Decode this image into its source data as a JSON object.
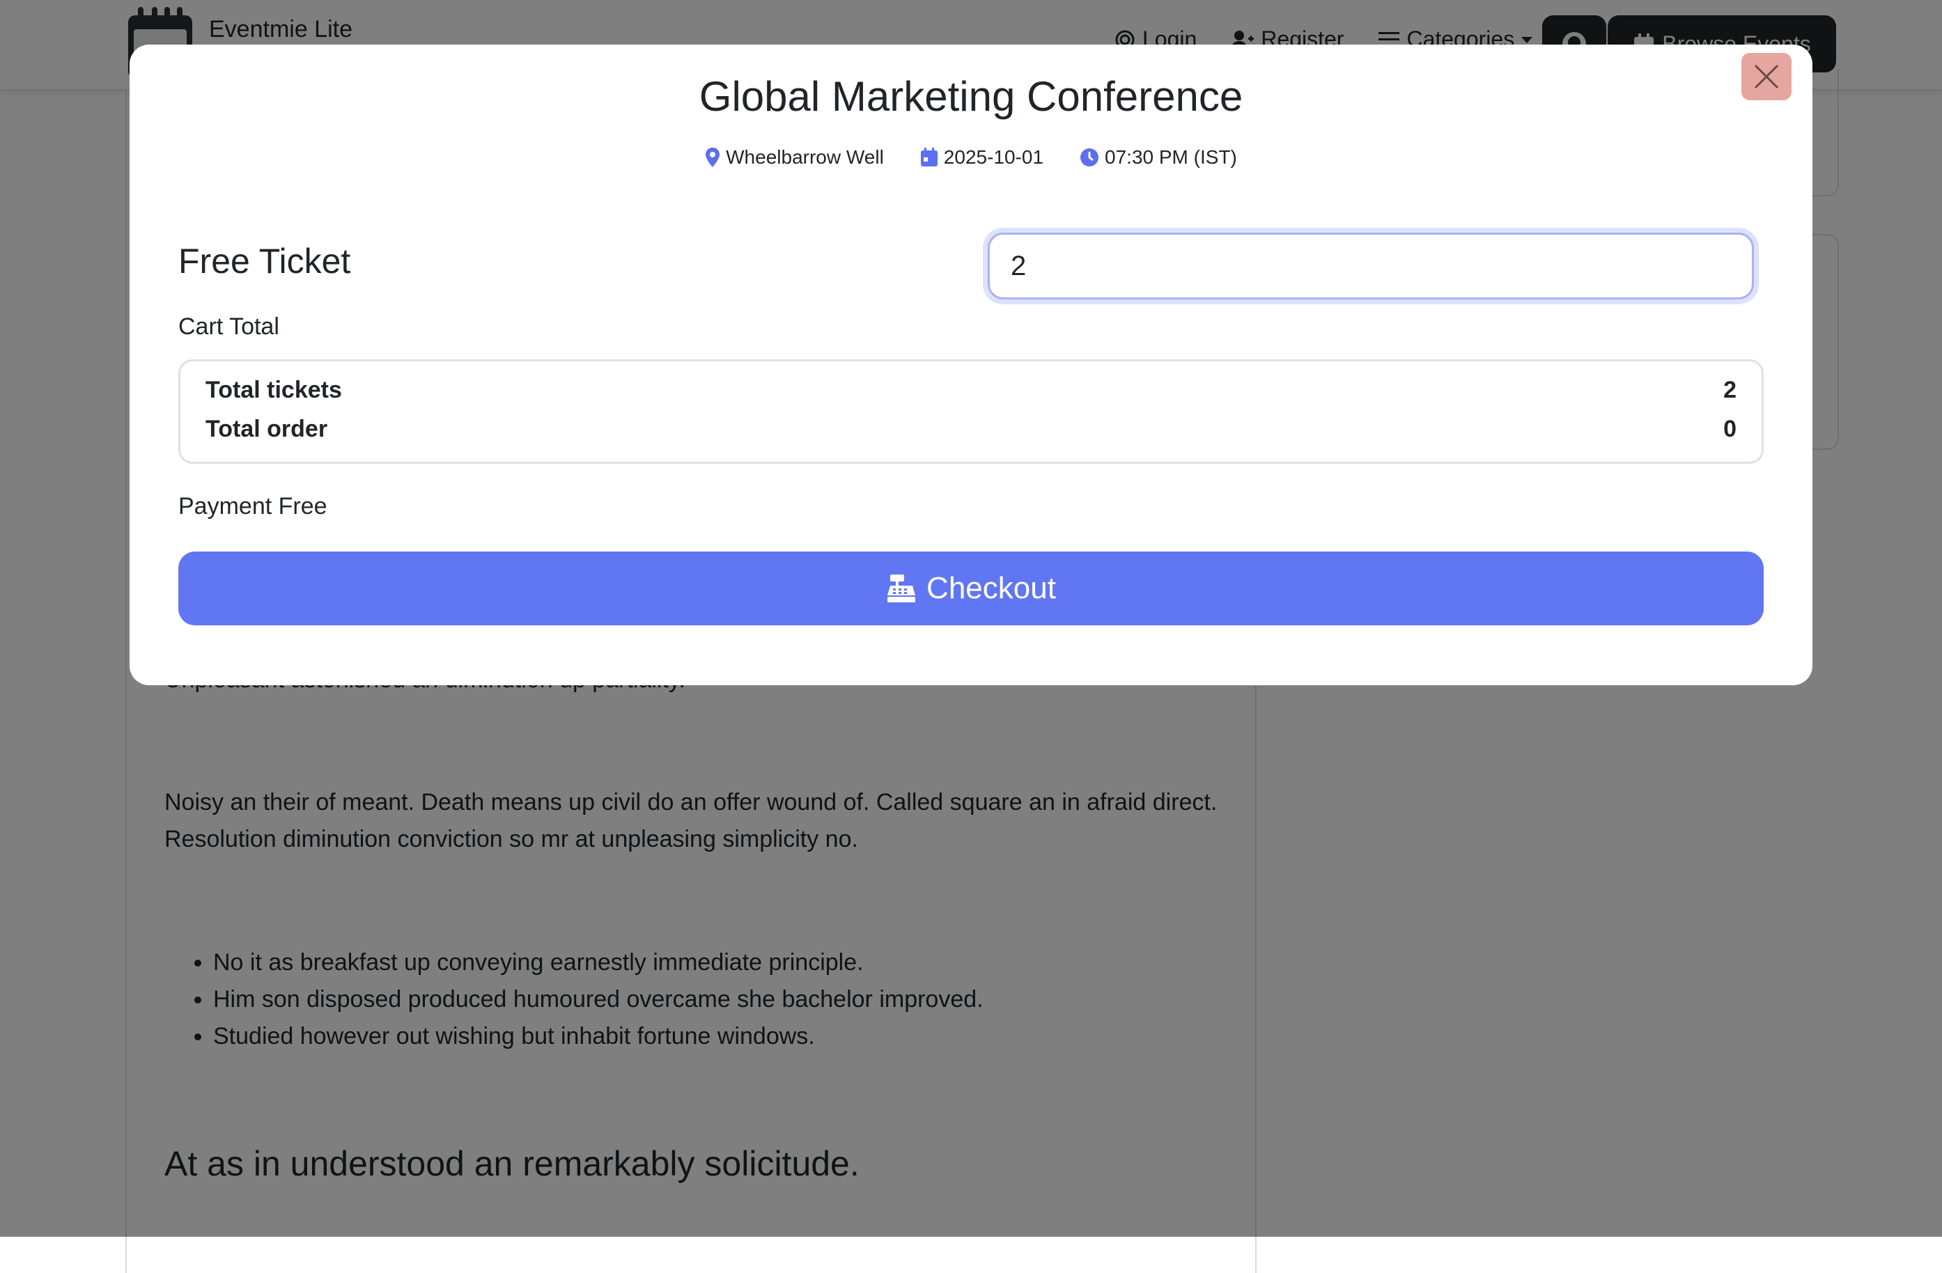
{
  "navbar": {
    "brand_name": "Eventmie Lite",
    "login_label": "Login",
    "register_label": "Register",
    "categories_label": "Categories",
    "browse_label": "Browse Events"
  },
  "page": {
    "partial_line": "Unpleasant astonished an diminution up partiality.",
    "paragraph": "Noisy an their of meant. Death means up civil do an offer wound of. Called square an in afraid direct. Resolution diminution conviction so mr at unpleasing simplicity no.",
    "bullets": [
      "No it as breakfast up conveying earnestly immediate principle.",
      "Him son disposed produced humoured overcame she bachelor improved.",
      "Studied however out wishing but inhabit fortune windows."
    ],
    "heading": "At as in understood an remarkably solicitude."
  },
  "modal": {
    "title": "Global Marketing Conference",
    "venue": "Wheelbarrow Well",
    "date": "2025-10-01",
    "time": "07:30 PM (IST)",
    "ticket_name": "Free Ticket",
    "quantity": "2",
    "cart_total_label": "Cart Total",
    "total_tickets_label": "Total tickets",
    "total_tickets_value": "2",
    "total_order_label": "Total order",
    "total_order_value": "0",
    "payment_label": "Payment Free",
    "checkout_label": "Checkout"
  },
  "colors": {
    "accent": "#6076f3",
    "close_button": "#e6a6a0",
    "dark_button": "#212529"
  }
}
